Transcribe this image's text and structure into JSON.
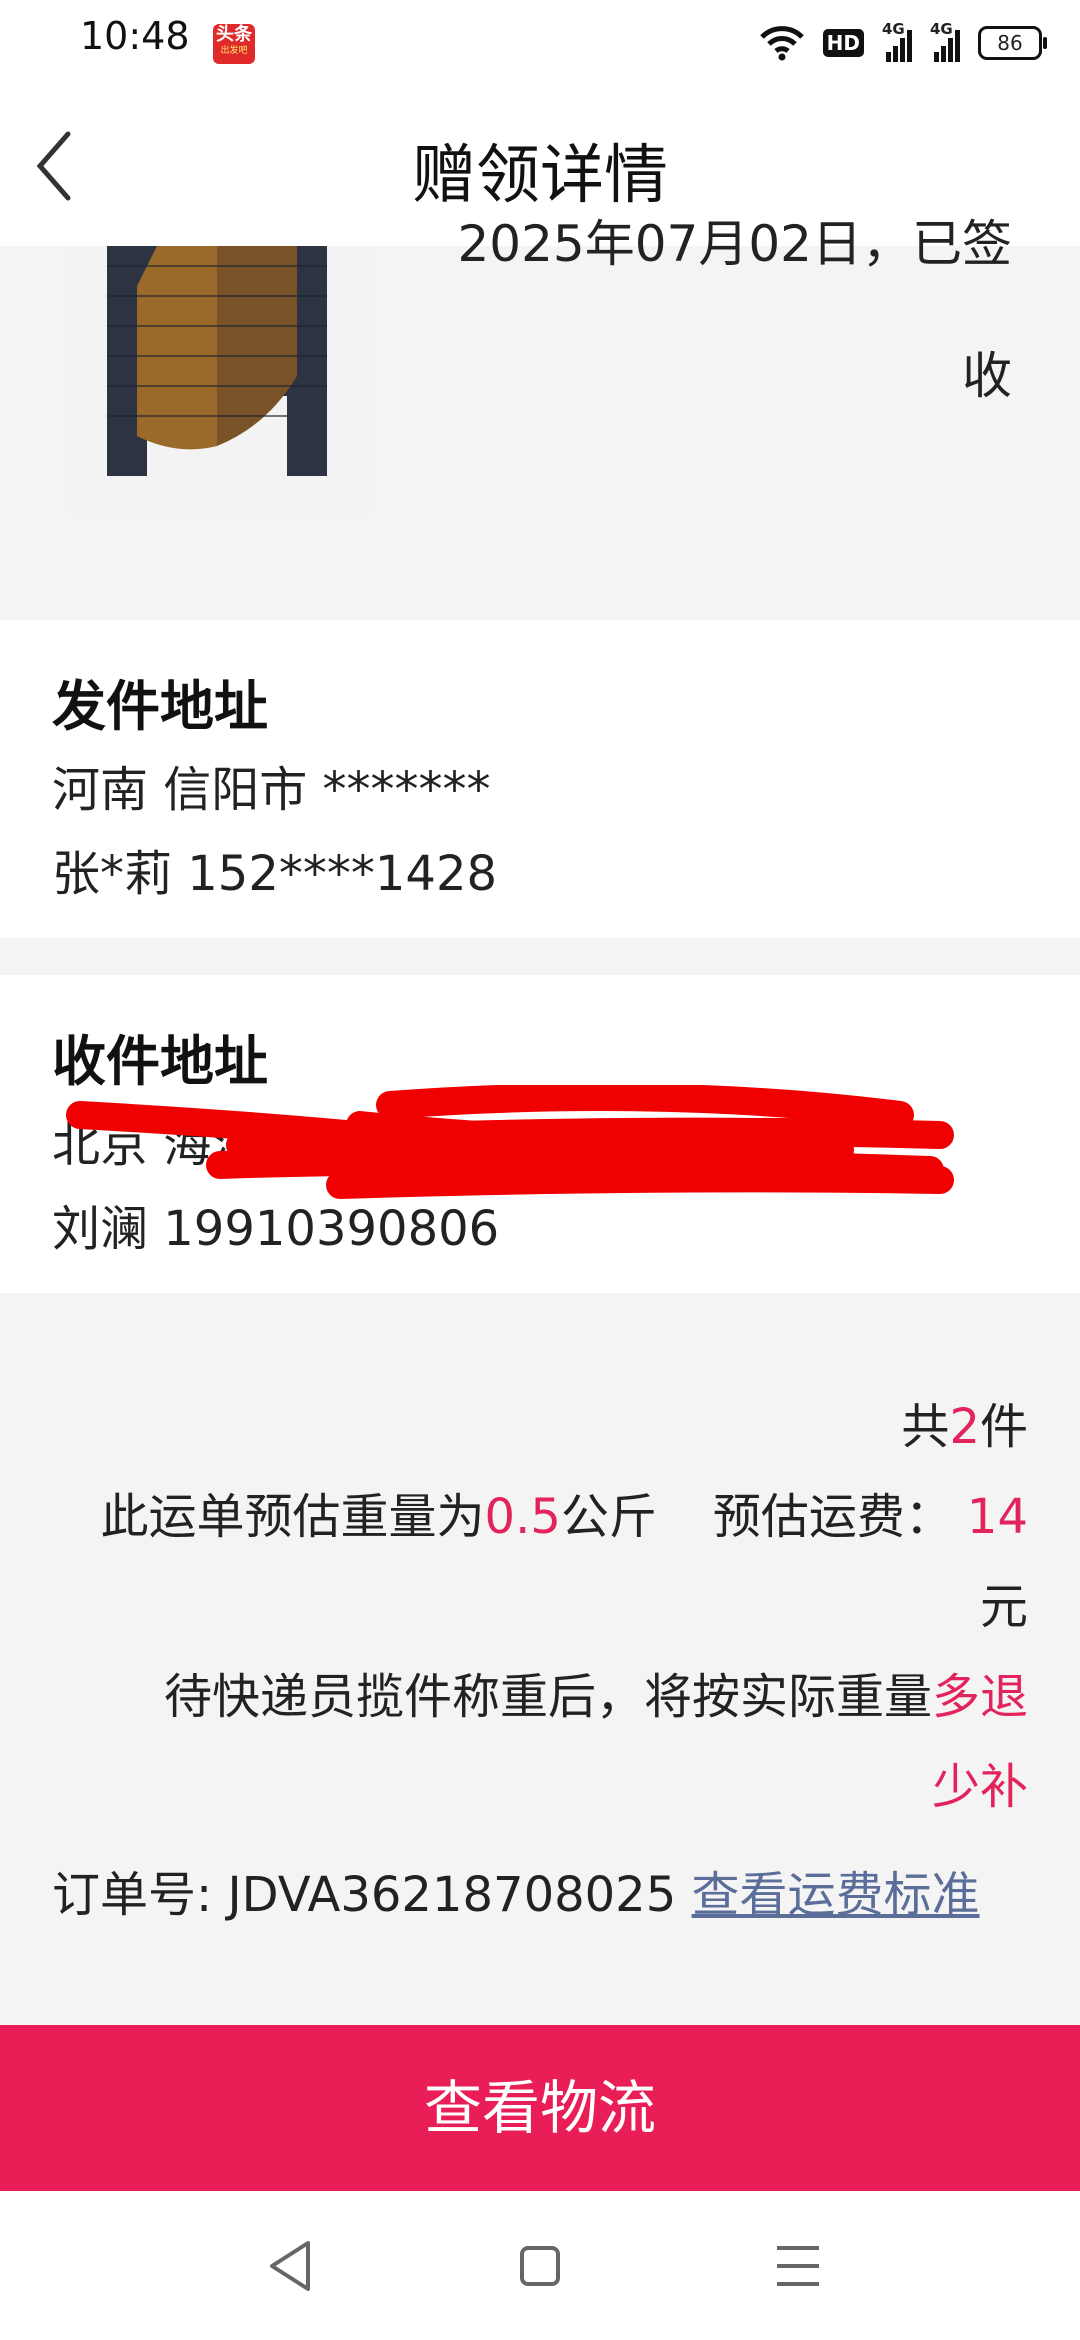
{
  "status_bar": {
    "time": "10:48",
    "app_badge": {
      "text": "头条",
      "sub": "出发吧"
    },
    "hd_label": "HD",
    "network_1": "4G",
    "network_2": "4G",
    "battery": "86"
  },
  "header": {
    "title": "赠领详情",
    "back_icon": "chevron-left-icon"
  },
  "order_status": {
    "line1": "2025年07月02日，已签",
    "line2": "收"
  },
  "sender": {
    "title": "发件地址",
    "address": "河南 信阳市 *******",
    "contact": "张*莉 152****1428"
  },
  "receiver": {
    "title": "收件地址",
    "address": "北京 海淀区",
    "contact": "刘澜 19910390806"
  },
  "shipment": {
    "count_prefix": "共",
    "count": "2",
    "count_suffix": "件",
    "weight_prefix": "此运单预估重量为",
    "weight_value": "0.5",
    "weight_unit": "公斤",
    "fee_label": "预估运费：",
    "fee_value": "14",
    "fee_unit": "元",
    "note_prefix": "待快递员揽件称重后，将按实际重量",
    "note_highlight_1": "多退",
    "note_highlight_2": "少补",
    "order_label": "订单号:",
    "order_number": "JDVA36218708025",
    "fee_link": "查看运费标准"
  },
  "actions": {
    "logistics_button": "查看物流"
  },
  "nav": [
    "back-triangle-icon",
    "home-square-icon",
    "menu-lines-icon"
  ],
  "colors": {
    "accent": "#e91e57",
    "highlight": "#e3245c",
    "link": "#5a6e99",
    "redaction": "#f00000"
  }
}
